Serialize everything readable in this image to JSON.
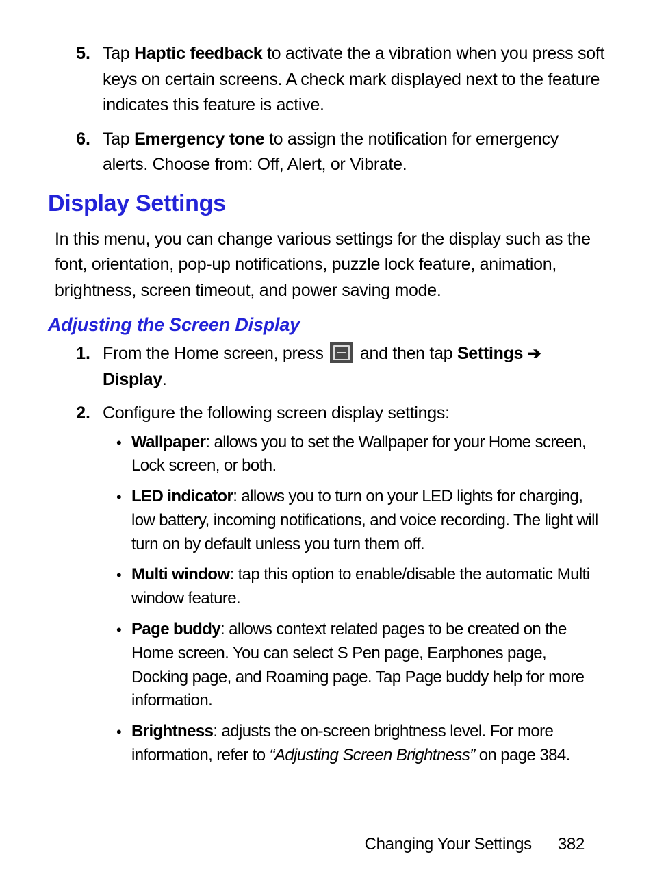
{
  "top_list": [
    {
      "num": "5.",
      "pre": "Tap ",
      "bold": "Haptic feedback",
      "post": " to activate the a vibration when you press soft keys on certain screens. A check mark displayed next to the feature indicates this feature is active."
    },
    {
      "num": "6.",
      "pre": "Tap ",
      "bold": "Emergency tone",
      "post": " to assign the notification for emergency alerts. Choose from: Off, Alert, or Vibrate."
    }
  ],
  "section_heading": "Display Settings",
  "section_intro": "In this menu, you can change various settings for the display such as the font, orientation, pop-up notifications, puzzle lock feature, animation, brightness, screen timeout, and power saving mode.",
  "subheading": "Adjusting the Screen Display",
  "step1": {
    "num": "1.",
    "pre": "From the Home screen, press ",
    "mid": " and then tap ",
    "bold1": "Settings",
    "arrow": " ➔ ",
    "bold2": "Display",
    "end": "."
  },
  "step2": {
    "num": "2.",
    "text": "Configure the following screen display settings:"
  },
  "bullets": [
    {
      "bold": "Wallpaper",
      "text": ": allows you to set the Wallpaper for your Home screen, Lock screen, or both."
    },
    {
      "bold": "LED indicator",
      "text": ": allows you to turn on your LED lights for charging, low battery, incoming notifications, and voice recording. The light will turn on by default unless you turn them off."
    },
    {
      "bold": "Multi window",
      "text": ": tap this option to enable/disable the automatic Multi window feature."
    },
    {
      "bold": "Page buddy",
      "text": ": allows context related pages to be created on the Home screen. You can select S Pen page, Earphones page, Docking page, and Roaming page. Tap Page buddy help for more information."
    },
    {
      "bold": "Brightness",
      "pre": ": adjusts the on-screen brightness level. For more information, refer to ",
      "italic": "“Adjusting Screen Brightness”",
      "post": "  on page 384."
    }
  ],
  "footer": {
    "title": "Changing Your Settings",
    "page": "382"
  }
}
